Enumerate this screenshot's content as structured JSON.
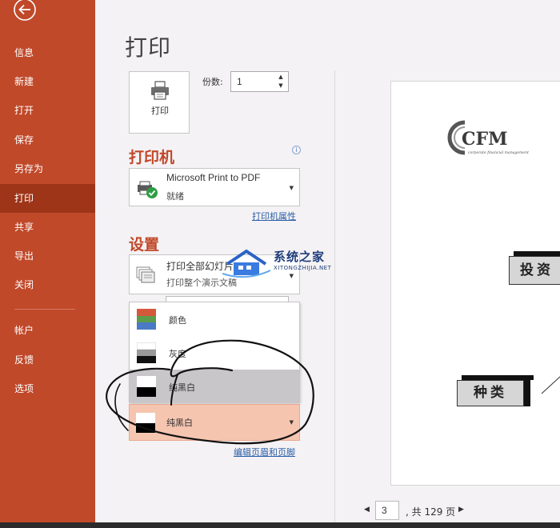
{
  "sidebar": {
    "back_label": "",
    "items": [
      {
        "label": "信息"
      },
      {
        "label": "新建"
      },
      {
        "label": "打开"
      },
      {
        "label": "保存"
      },
      {
        "label": "另存为"
      },
      {
        "label": "打印",
        "active": true
      },
      {
        "label": "共享"
      },
      {
        "label": "导出"
      },
      {
        "label": "关闭"
      },
      {
        "label": "帐户"
      },
      {
        "label": "反馈"
      },
      {
        "label": "选项"
      }
    ]
  },
  "page": {
    "title": "打印",
    "print_button_label": "打印",
    "copies_label": "份数:",
    "copies_value": "1"
  },
  "printer": {
    "section_title": "打印机",
    "name": "Microsoft Print to PDF",
    "status": "就绪",
    "properties_link": "打印机属性"
  },
  "settings": {
    "section_title": "设置",
    "range_title": "打印全部幻灯片",
    "range_desc": "打印整个演示文稿",
    "color_options": [
      {
        "label": "颜色"
      },
      {
        "label": "灰度"
      },
      {
        "label": "纯黑白",
        "hover": true
      }
    ],
    "color_selected": "纯黑白",
    "header_footer_link": "编辑页眉和页脚"
  },
  "preview": {
    "logo_text": "CFM",
    "logo_subtitle": "corporate financial management",
    "box1": "投资",
    "box2": "种类"
  },
  "pager": {
    "current_page": "3",
    "total_text": ", 共 129 页"
  },
  "watermark": {
    "title": "系统之家",
    "url": "XITONGZHIJIA.NET"
  },
  "colors": {
    "accent": "#c0492a",
    "accent_dark": "#9e3519",
    "selected_bg": "#f6c5b0",
    "link": "#2a5ea8"
  }
}
